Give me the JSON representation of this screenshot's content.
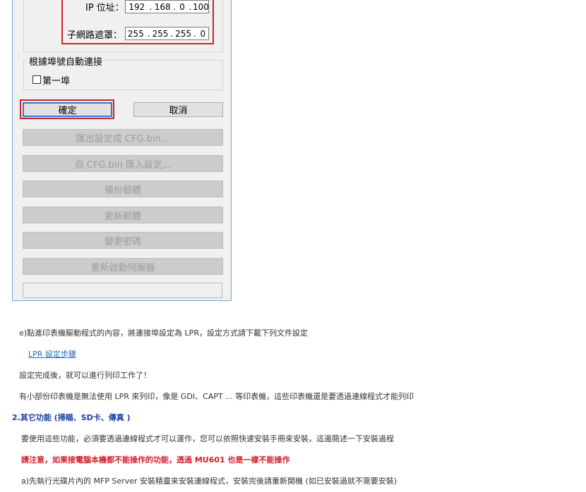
{
  "dialog": {
    "ip_label": "IP 位址：",
    "ip_segments": [
      "192",
      "168",
      "0",
      "100"
    ],
    "subnet_label": "子網路遮罩：",
    "subnet_segments": [
      "255",
      "255",
      "255",
      "0"
    ],
    "auto_connect_group": "根據埠號自動連接",
    "first_port_label": "第一埠",
    "ok_label": "確定",
    "cancel_label": "取消",
    "buttons": [
      "匯出設定成 CFG.bin...",
      "自 CFG.bin 匯入設定...",
      "備份韌體",
      "更新韌體",
      "變更密碼",
      "重新啟動伺服器"
    ]
  },
  "article": {
    "step_e": "e)點進印表機驅動程式的內容，將連接埠設定為 LPR，設定方式請下載下列文件設定",
    "lpr_link": "LPR 設定步驟",
    "done_text": "設定完成後，就可以進行列印工作了！",
    "note_text": "有小部份印表機是無法使用 LPR 來列印，像是 GDI、CAPT ... 等印表機，這些印表機還是要透過連線程式才能列印",
    "section_heading": "2.其它功能 (掃瞄、SD卡、傳真 )",
    "section_intro": "要使用這些功能，必須要透過連線程式才可以運作，您可以依照快速安裝手冊來安裝，這邊簡述一下安裝過程",
    "warning": "請注意，如果接電腦本機都不能操作的功能，透過 MU601 也是一樣不能操作",
    "step_a": "a)先執行光碟片內的 MFP Server 安裝精靈來安裝連線程式，安裝完後請重新開機 (如已安裝過就不需要安裝)"
  },
  "colors": {
    "highlight_red": "#d3202a",
    "heading_blue": "#1f3fa5",
    "link_blue": "#2a6bb3"
  }
}
